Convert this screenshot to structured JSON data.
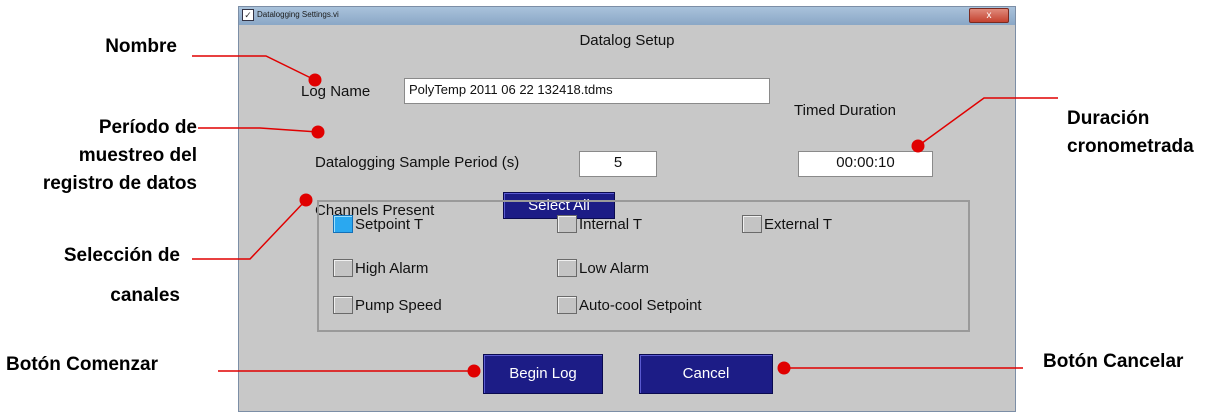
{
  "window": {
    "title": "Datalogging Settings.vi",
    "close_glyph": "x",
    "panel_title": "Datalog Setup"
  },
  "form": {
    "log_name_label": "Log Name",
    "log_name_value": "PolyTemp 2011 06 22 132418.tdms",
    "sample_period_label": "Datalogging Sample Period (s)",
    "sample_period_value": "5",
    "timed_duration_label": "Timed Duration",
    "timed_duration_value": "00:00:10",
    "channels_label": "Channels Present",
    "select_all_label": "Select All"
  },
  "channels": [
    {
      "label": "Setpoint T",
      "checked": true
    },
    {
      "label": "Internal T",
      "checked": false
    },
    {
      "label": "External T",
      "checked": false
    },
    {
      "label": "High Alarm",
      "checked": false
    },
    {
      "label": "Low Alarm",
      "checked": false
    },
    {
      "label": "Pump Speed",
      "checked": false
    },
    {
      "label": "Auto-cool Setpoint",
      "checked": false
    }
  ],
  "buttons": {
    "begin_log": "Begin Log",
    "cancel": "Cancel"
  },
  "annotations": {
    "nombre": "Nombre",
    "periodo_1": "Período de",
    "periodo_2": "muestreo del",
    "periodo_3": "registro de datos",
    "seleccion_1": "Selección de",
    "seleccion_2": "canales",
    "comenzar": "Botón Comenzar",
    "duracion_1": "Duración",
    "duracion_2": "cronometrada",
    "cancelar": "Botón Cancelar"
  },
  "colors": {
    "callout_line": "#e00000",
    "navy_button": "#1c1c86",
    "checked_box": "#2aa8f0",
    "panel_bg": "#c8c8c8"
  }
}
